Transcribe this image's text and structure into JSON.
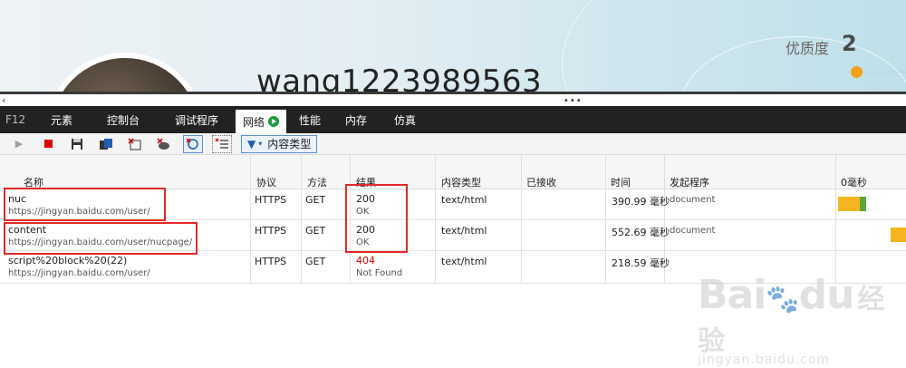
{
  "profile": {
    "username": "wang1223989563",
    "quality_label": "优质度",
    "quality_value": "2"
  },
  "devtools": {
    "f12": "F12",
    "tabs": [
      "元素",
      "控制台",
      "调试程序",
      "网络",
      "性能",
      "内存",
      "仿真"
    ],
    "active_tab": "网络",
    "filter_label": "内容类型",
    "columns": {
      "name": "名称",
      "protocol": "协议",
      "method": "方法",
      "result": "结果",
      "type": "内容类型",
      "received": "已接收",
      "time": "时间",
      "initiator": "发起程序",
      "timeline": "0毫秒"
    },
    "requests": [
      {
        "name": "nuc",
        "url": "https://jingyan.baidu.com/user/",
        "protocol": "HTTPS",
        "method": "GET",
        "status": "200",
        "status_text": "OK",
        "type": "text/html",
        "received": "",
        "time": "390.99 毫秒",
        "initiator": "document"
      },
      {
        "name": "content",
        "url": "https://jingyan.baidu.com/user/nucpage/",
        "protocol": "HTTPS",
        "method": "GET",
        "status": "200",
        "status_text": "OK",
        "type": "text/html",
        "received": "",
        "time": "552.69 毫秒",
        "initiator": "document"
      },
      {
        "name": "script%20block%20(22)",
        "url": "https://jingyan.baidu.com/user/",
        "protocol": "HTTPS",
        "method": "GET",
        "status": "404",
        "status_text": "Not Found",
        "type": "text/html",
        "received": "",
        "time": "218.59 毫秒",
        "initiator": ""
      }
    ]
  },
  "watermark": {
    "logo": "Bai",
    "logo_du": "du",
    "cn": "经验",
    "domain": "jingyan.baidu.com"
  },
  "colors": {
    "tabbar_bg": "#222222",
    "status_error": "#d00000",
    "annotation_red": "#e22929",
    "timeline_wait": "#f6b51e",
    "timeline_receive": "#5aa83a",
    "quality_accent": "#f6a11a"
  }
}
